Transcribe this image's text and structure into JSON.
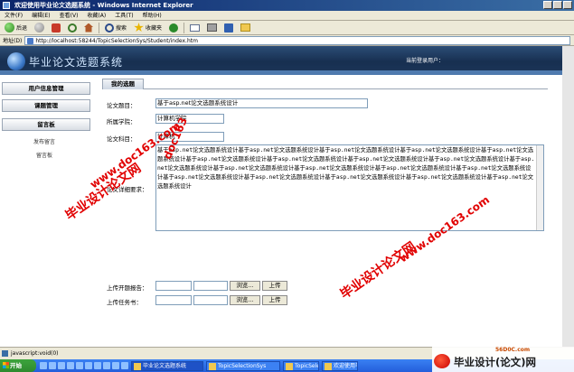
{
  "window": {
    "title": "欢迎使用毕业论文选题系统 - Windows Internet Explorer"
  },
  "menu": [
    "文件(F)",
    "编辑(E)",
    "查看(V)",
    "收藏(A)",
    "工具(T)",
    "帮助(H)"
  ],
  "toolbar": {
    "back": "后退",
    "search": "搜索",
    "favorites": "收藏夹"
  },
  "address": {
    "label": "地址(D)",
    "url": "http://localhost:58244/TopicSelectionSys/Student/index.htm"
  },
  "banner": {
    "title": "毕业论文选题系统",
    "login": "当前登录用户："
  },
  "sidebar": {
    "sections": [
      "用户信息管理",
      "课题管理",
      "留言板"
    ],
    "subitems": [
      "发布留言",
      "留言板"
    ]
  },
  "main": {
    "tab": "我的选题",
    "fields": {
      "topic_label": "论文题目：",
      "topic_value": "基于asp.net论文选题系统设计",
      "college_label": "所属学院：",
      "college_value": "计算机学院",
      "subject_label": "论文科目：",
      "subject_value": "计算机",
      "detail_label": "论文详细要求：",
      "detail_value": "基于asp.net论文选题系统设计基于asp.net论文选题系统设计基于asp.net论文选题系统设计基于asp.net论文选题系统设计基于asp.net论文选题系统设计基于asp.net论文选题系统设计基于asp.net论文选题系统设计基于asp.net论文选题系统设计基于asp.net论文选题系统设计基于asp.net论文选题系统设计基于asp.net论文选题系统设计基于asp.net论文选题系统设计基于asp.net论文选题系统设计基于asp.net论文选题系统设计基于asp.net论文选题系统设计基于asp.net论文选题系统设计基于asp.net论文选题系统设计基于asp.net论文选题系统设计基于asp.net论文选题系统设计",
      "proposal_label": "上传开题报告：",
      "task_label": "上传任务书：",
      "browse": "浏览...",
      "upload": "上传"
    }
  },
  "status": {
    "text": "javascript:void(0)"
  },
  "taskbar": {
    "start": "开始",
    "tasks": [
      "毕业论文选题系统",
      "TopicSelectionSys",
      "TopicSelectionSys",
      "欢迎使用毕业论文..."
    ]
  },
  "watermarks": {
    "cn": "毕业设计论文网",
    "url": "www.doc163.com",
    "url_short": "doc163",
    "site": "56D0C.com",
    "logo": "毕业设计(论文)网"
  },
  "colors": {
    "watermark": "#e10000",
    "banner": "#1c365a",
    "taskbar": "#245edb"
  }
}
